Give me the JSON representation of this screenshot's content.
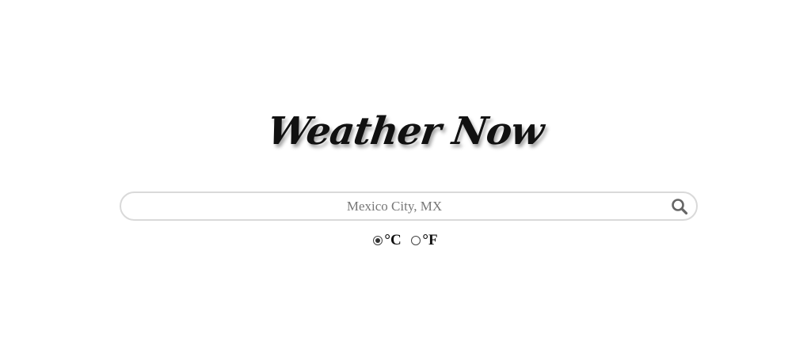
{
  "app": {
    "title": "Weather Now"
  },
  "search": {
    "placeholder": "Mexico City, MX",
    "value": "",
    "icon": "search-icon"
  },
  "units": {
    "celsius_label": "°C",
    "fahrenheit_label": "°F",
    "selected": "celsius"
  }
}
